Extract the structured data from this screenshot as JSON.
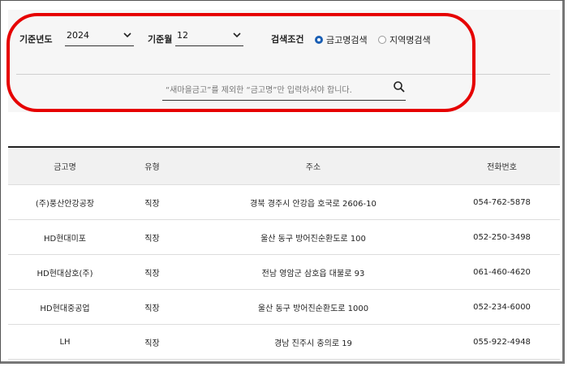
{
  "filters": {
    "year_label": "기준년도",
    "year_value": "2024",
    "month_label": "기준월",
    "month_value": "12",
    "condition_label": "검색조건",
    "radio_options": [
      {
        "label": "금고명검색",
        "checked": true
      },
      {
        "label": "지역명검색",
        "checked": false
      }
    ],
    "search_placeholder": "“새마을금고”를 제외한 “금고명”만 입력하셔야 합니다."
  },
  "table": {
    "headers": [
      "금고명",
      "유형",
      "주소",
      "전화번호"
    ],
    "rows": [
      [
        "(주)풍산안강공장",
        "직장",
        "경북 경주시 안강읍 호국로 2606-10",
        "054-762-5878"
      ],
      [
        "HD현대미포",
        "직장",
        "울산 동구 방어진순환도로 100",
        "052-250-3498"
      ],
      [
        "HD현대삼호(주)",
        "직장",
        "전남 영암군 삼호읍 대불로 93",
        "061-460-4620"
      ],
      [
        "HD현대중공업",
        "직장",
        "울산 동구 방어진순환도로 1000",
        "052-234-6000"
      ],
      [
        "LH",
        "직장",
        "경남 진주시 충의로 19",
        "055-922-4948"
      ]
    ]
  },
  "colors": {
    "highlight": "#e60000",
    "radio_checked": "#1a5fb4"
  }
}
